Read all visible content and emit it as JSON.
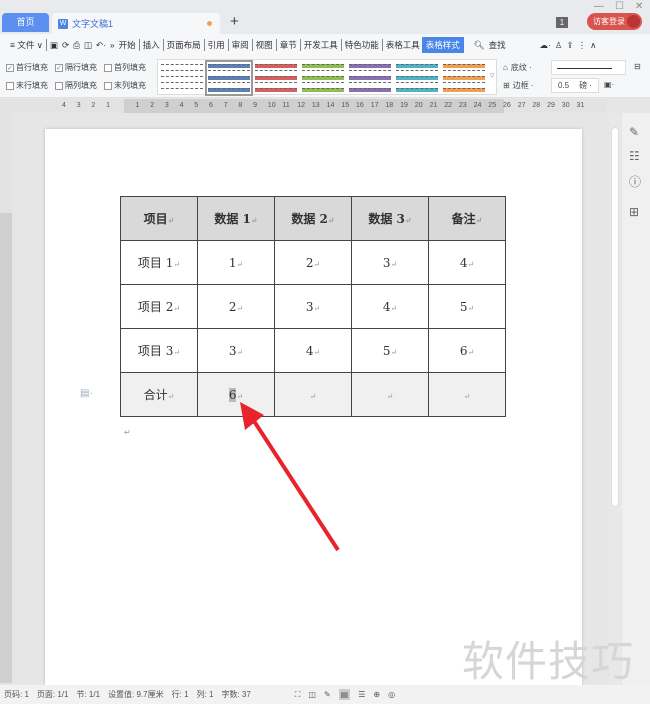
{
  "titlebar": {
    "tabs": [
      {
        "label": "首页"
      },
      {
        "label": "文字文稿1"
      }
    ],
    "doc_icon": "W",
    "new_tab": "+",
    "badge": "1",
    "login": "访客登录",
    "min": "—",
    "max": "☐",
    "close": "✕"
  },
  "menubar": {
    "file": "≡ 文件 ∨",
    "quick_icons": [
      "save-icon",
      "format-painter-icon",
      "print-icon",
      "preview-icon",
      "undo-icon"
    ],
    "more": "»",
    "items": [
      "开始",
      "插入",
      "页面布局",
      "引用",
      "审阅",
      "视图",
      "章节",
      "开发工具",
      "特色功能",
      "表格工具"
    ],
    "active": "表格样式",
    "search": "查找"
  },
  "toolbar": {
    "checkboxes": [
      {
        "label": "首行填充",
        "checked": true
      },
      {
        "label": "隔行填充",
        "checked": true
      },
      {
        "label": "首列填充",
        "checked": false
      },
      {
        "label": "末行填充",
        "checked": false
      },
      {
        "label": "隔列填充",
        "checked": false
      },
      {
        "label": "末列填充",
        "checked": false
      }
    ],
    "style_colors": [
      "#ffffff",
      "#5b80b8",
      "#d95f5f",
      "#8fbf4f",
      "#8a6fb5",
      "#4fb3c8",
      "#f0a050"
    ],
    "shading": "底纹 ·",
    "border": "边框 ·",
    "line_width": "0.5",
    "unit": "磅 ·"
  },
  "ruler": {
    "ticks": [
      "4",
      "3",
      "2",
      "1",
      "",
      "1",
      "2",
      "3",
      "4",
      "5",
      "6",
      "7",
      "8",
      "9",
      "10",
      "11",
      "12",
      "13",
      "14",
      "15",
      "16",
      "17",
      "18",
      "19",
      "20",
      "21",
      "22",
      "23",
      "24",
      "25",
      "26",
      "27",
      "28",
      "29",
      "30",
      "31"
    ]
  },
  "table": {
    "header": [
      "项目",
      "数据 1",
      "数据 2",
      "数据 3",
      "备注"
    ],
    "rows": [
      [
        "项目 1",
        "1",
        "2",
        "3",
        "4"
      ],
      [
        "项目 2",
        "2",
        "3",
        "4",
        "5"
      ],
      [
        "项目 3",
        "3",
        "4",
        "5",
        "6"
      ],
      [
        "合计",
        "6",
        "",
        "",
        ""
      ]
    ],
    "para_mark": "↵"
  },
  "statusbar": {
    "page": "页码: 1",
    "pages": "页面: 1/1",
    "section": "节: 1/1",
    "setting": "设置值: 9.7厘米",
    "row": "行: 1",
    "col": "列: 1",
    "words": "字数: 37"
  },
  "watermark": "软件技巧"
}
